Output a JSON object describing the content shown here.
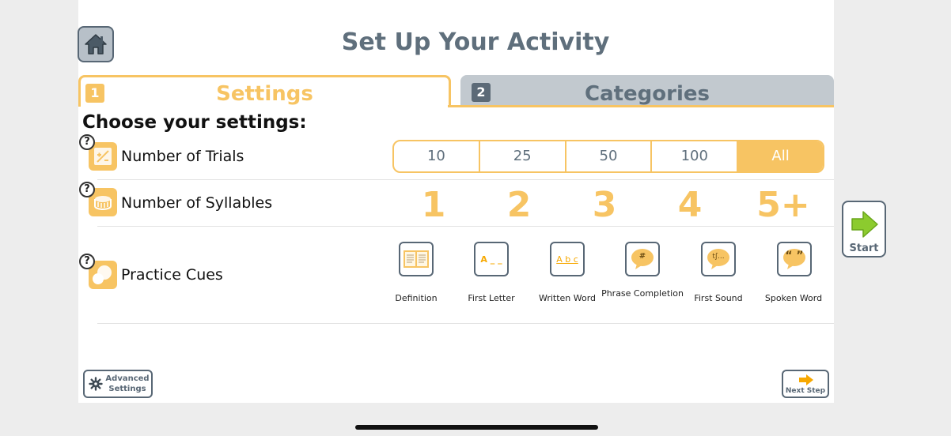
{
  "header": {
    "title": "Set Up Your Activity",
    "home_icon": "home-icon"
  },
  "tabs": [
    {
      "number": "1",
      "label": "Settings",
      "active": true
    },
    {
      "number": "2",
      "label": "Categories",
      "active": false
    }
  ],
  "settings": {
    "heading": "Choose your settings:",
    "help_symbol": "?",
    "trials": {
      "label": "Number of Trials",
      "options": [
        "10",
        "25",
        "50",
        "100",
        "All"
      ],
      "selected": "All"
    },
    "syllables": {
      "label": "Number of Syllables",
      "options": [
        "1",
        "2",
        "3",
        "4",
        "5+"
      ]
    },
    "cues": {
      "label": "Practice Cues",
      "items": [
        {
          "label": "Definition",
          "icon": "book-icon"
        },
        {
          "label": "First Letter",
          "icon": "first-letter-icon",
          "glyph": "A _ _"
        },
        {
          "label": "Written Word",
          "icon": "written-word-icon",
          "glyph": "A b c"
        },
        {
          "label": "Phrase Completion",
          "icon": "phrase-bubble-icon",
          "glyph": "#"
        },
        {
          "label": "First Sound",
          "icon": "sound-bubble-icon",
          "glyph": "tʃ..."
        },
        {
          "label": "Spoken Word",
          "icon": "quote-bubble-icon",
          "glyph": "“ ”"
        }
      ]
    }
  },
  "buttons": {
    "start": "Start",
    "advanced": "Advanced Settings",
    "next": "Next Step"
  },
  "colors": {
    "accent": "#f7c463",
    "slate": "#5f6f7c",
    "tab_inactive": "#c2c9cf",
    "background": "#ededed"
  }
}
